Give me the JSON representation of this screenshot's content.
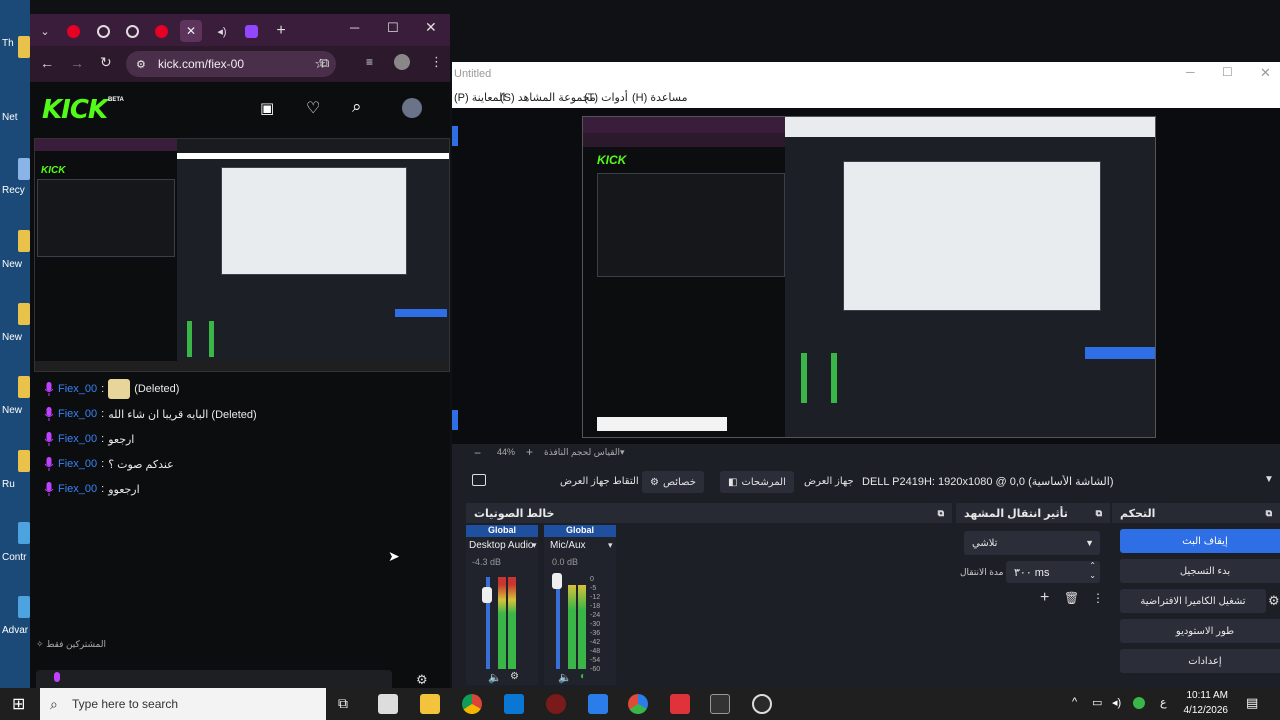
{
  "desktop": {
    "labels": [
      "Th",
      "Net",
      "Recy",
      "New",
      "New",
      "New",
      "Ru",
      "Contr",
      "Advar"
    ]
  },
  "chrome": {
    "url": "kick.com/fiex-00",
    "tabs": [
      "pinterest-icon",
      "whatsapp-icon",
      "whatsapp-icon",
      "pinterest-icon",
      "close-icon",
      "audio-icon",
      "twitch-icon"
    ],
    "kick": {
      "logo": "KICK",
      "beta": "BETA"
    },
    "chat": {
      "messages": [
        {
          "user": "Fiex_00",
          "sep": ":",
          "text": "(Deleted)",
          "has_avatar": true
        },
        {
          "user": "Fiex_00",
          "sep": ":",
          "text": "البايه قريبا ان شاء الله (Deleted)",
          "has_avatar": false
        },
        {
          "user": "Fiex_00",
          "sep": ":",
          "text": "ارجعو",
          "has_avatar": false
        },
        {
          "user": "Fiex_00",
          "sep": ":",
          "text": "عندكم صوت ؟",
          "has_avatar": false
        },
        {
          "user": "Fiex_00",
          "sep": ":",
          "text": "ارجعوو",
          "has_avatar": false
        }
      ],
      "subscribers_only": "المشتركين فقط"
    }
  },
  "obs": {
    "title": "Untitled",
    "menu": [
      "(P) المعاينة",
      "(S) مجموعة المشاهد",
      "(T) أدوات",
      "(H) مساعدة"
    ],
    "zoom": "44%",
    "zoom_label": "القياس لحجم النافذة",
    "source_bar": {
      "capture": "التقاط جهاز العرض",
      "properties": "خصائص",
      "filters": "المرشحات",
      "device_label": "جهاز العرض",
      "device": "DELL P2419H: 1920x1080 @ 0,0 (الشاشة الأساسية)"
    },
    "mixer": {
      "title": "خالط الصوتيات",
      "channels": [
        {
          "global": "Global",
          "name": "Desktop Audio",
          "db": "-4.3 dB",
          "level": 0.7
        },
        {
          "global": "Global",
          "name": "Mic/Aux",
          "db": "0.0 dB",
          "level": 0.62
        }
      ],
      "scale": [
        "0",
        "-5",
        "-12",
        "-18",
        "-24",
        "-30",
        "-36",
        "-42",
        "-48",
        "-54",
        "-60"
      ]
    },
    "transitions": {
      "title": "تأثير انتقال المشهد",
      "type": "تلاشي",
      "duration_label": "مدة الانتقال",
      "duration": "٣٠٠ ms"
    },
    "controls": {
      "title": "التحكم",
      "buttons": [
        "إيقاف البث",
        "بدء التسجيل",
        "تشغيل الكاميرا الافتراضية",
        "طور الاستوديو",
        "إعدادات"
      ]
    }
  },
  "taskbar": {
    "search_placeholder": "Type here to search",
    "time": "10:11 AM",
    "date": "4/12/2026",
    "lang": "ع"
  }
}
